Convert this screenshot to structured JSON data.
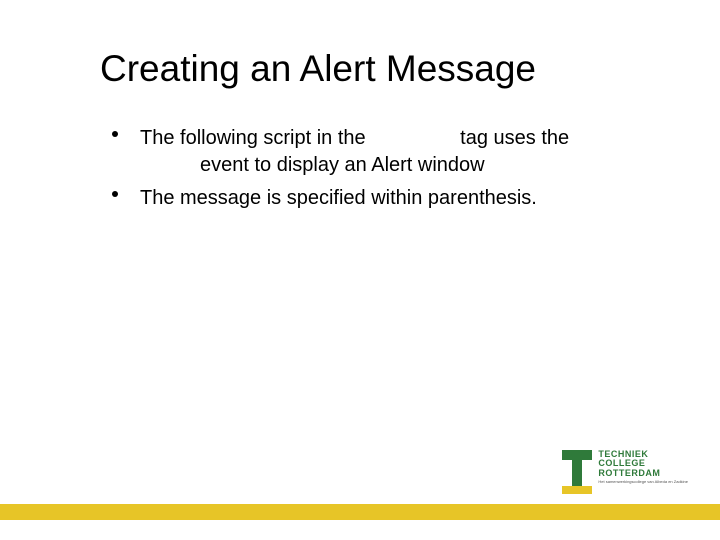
{
  "title": "Creating an Alert Message",
  "bullets": [
    {
      "line1a": "The following script in the ",
      "line1b": " tag uses the",
      "line2": "event to display an Alert window"
    },
    {
      "line1": "The message is specified within parenthesis."
    }
  ],
  "logo": {
    "word1": "TECHNIEK",
    "word2": "COLLEGE",
    "word3": "ROTTERDAM",
    "tagline": "Het samenwerkingscollege van Albeda en Zadkine"
  }
}
